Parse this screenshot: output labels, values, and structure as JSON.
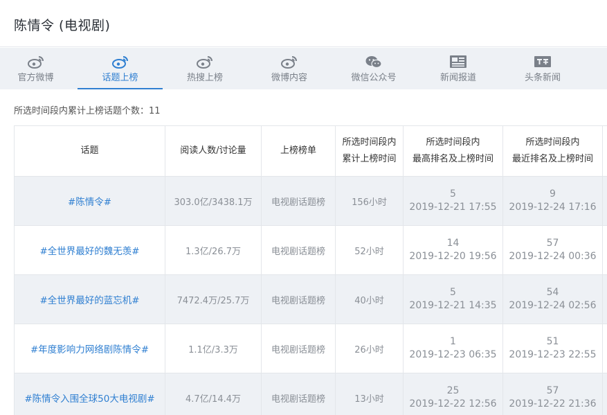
{
  "page": {
    "title": "陈情令 (电视剧)"
  },
  "tabs": [
    {
      "label": "官方微博",
      "icon": "weibo-icon"
    },
    {
      "label": "话题上榜",
      "icon": "weibo-icon",
      "active": true
    },
    {
      "label": "热搜上榜",
      "icon": "weibo-icon"
    },
    {
      "label": "微博内容",
      "icon": "weibo-icon"
    },
    {
      "label": "微信公众号",
      "icon": "wechat-icon"
    },
    {
      "label": "新闻报道",
      "icon": "news-icon"
    },
    {
      "label": "头条新闻",
      "icon": "toutiao-icon"
    }
  ],
  "summary": {
    "text": "所选时间段内累计上榜话题个数：11"
  },
  "table": {
    "headers": {
      "topic": "话题",
      "reads": "阅读人数/讨论量",
      "board": "上榜榜单",
      "hours_l1": "所选时间段内",
      "hours_l2": "累计上榜时间",
      "best_l1": "所选时间段内",
      "best_l2": "最高排名及上榜时间",
      "recent_l1": "所选时间段内",
      "recent_l2": "最近排名及上榜时间"
    },
    "rows": [
      {
        "topic": "#陈情令#",
        "reads": "303.0亿/3438.1万",
        "board": "电视剧话题榜",
        "hours": "156小时",
        "best_rank": "5",
        "best_time": "2019-12-21 17:55",
        "recent_rank": "9",
        "recent_time": "2019-12-24 17:16"
      },
      {
        "topic": "#全世界最好的魏无羡#",
        "reads": "1.3亿/26.7万",
        "board": "电视剧话题榜",
        "hours": "52小时",
        "best_rank": "14",
        "best_time": "2019-12-20 19:56",
        "recent_rank": "57",
        "recent_time": "2019-12-24 00:36"
      },
      {
        "topic": "#全世界最好的蓝忘机#",
        "reads": "7472.4万/25.7万",
        "board": "电视剧话题榜",
        "hours": "40小时",
        "best_rank": "5",
        "best_time": "2019-12-21 14:35",
        "recent_rank": "54",
        "recent_time": "2019-12-24 02:56"
      },
      {
        "topic": "#年度影响力网络剧陈情令#",
        "reads": "1.1亿/3.3万",
        "board": "电视剧话题榜",
        "hours": "26小时",
        "best_rank": "1",
        "best_time": "2019-12-23 06:35",
        "recent_rank": "51",
        "recent_time": "2019-12-23 22:55"
      },
      {
        "topic": "#陈情令入围全球50大电视剧#",
        "reads": "4.7亿/14.4万",
        "board": "电视剧话题榜",
        "hours": "13小时",
        "best_rank": "25",
        "best_time": "2019-12-22 12:56",
        "recent_rank": "57",
        "recent_time": "2019-12-22 21:36"
      }
    ]
  },
  "colors": {
    "accent": "#2f7fd1",
    "tab_bg": "#eef1f5",
    "row_alt": "#eef1f5"
  }
}
